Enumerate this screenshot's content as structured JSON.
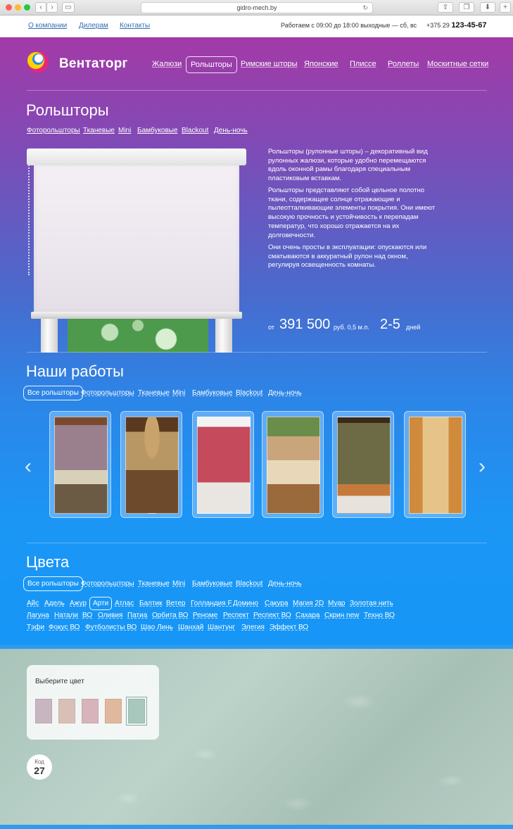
{
  "browser": {
    "url": "gidro-mech.by"
  },
  "topbar": {
    "links": [
      "О компании",
      "Дилерам",
      "Контакты"
    ],
    "hours": "Работаем с 09:00 до 18:00   выходные — сб, вс",
    "phone_prefix": "+375 29",
    "phone_number": "123-45-67"
  },
  "brand": {
    "name": "Вентаторг"
  },
  "nav": {
    "items": [
      "Жалюзи",
      "Рольшторы",
      "Римские шторы",
      "Японские",
      "Плиссе",
      "Роллеты",
      "Москитные сетки"
    ],
    "active": "Рольшторы"
  },
  "product": {
    "title": "Рольшторы",
    "subnav": [
      "Фоторольшторы",
      "Тканевые",
      "Mini",
      "Бамбуковые",
      "Blackout",
      "День-ночь"
    ],
    "paragraphs": [
      "Рольшторы (рулонные шторы) – декоративный вид рулонных жалюзи, которые удобно  перемещаются вдоль оконной рамы благодаря специальным пластиковым вставкам.",
      "Рольшторы представляют собой цельное полотно ткани, содержащее солнце отражающие и пылеотталкивающие элементы покрытия. Они имеют высокую прочность и устойчивость к перепадам температур, что хорошо отражается на их долговечности.",
      "Они очень просты в эксплуатации:  опускаются или сматываются в аккуратный рулон над окном, регулируя освещенность комнаты."
    ],
    "price_from": "от",
    "price": "391 500",
    "price_unit": "руб. 0,5 м.п.",
    "days": "2-5",
    "days_unit": "дней"
  },
  "works": {
    "title": "Наши работы",
    "filters": [
      "Все рольшторы",
      "Фоторольшторы",
      "Тканевые",
      "Mini",
      "Бамбуковые",
      "Blackout",
      "День-ночь"
    ],
    "photos": [
      "photo-1",
      "photo-2",
      "photo-3",
      "photo-4",
      "photo-5",
      "photo-6"
    ]
  },
  "colors": {
    "title": "Цвета",
    "filters": [
      "Все рольшторы",
      "Фоторольшторы",
      "Тканевые",
      "Mini",
      "Бамбуковые",
      "Blackout",
      "День-ночь"
    ],
    "row1": [
      "Айс",
      "Адель",
      "Ажур",
      "Арти",
      "Атлас",
      "Балтик",
      "Ветер",
      "Голландия F",
      "Домино",
      "Сакура",
      "Магия 2D",
      "Муар",
      "Золотая нить"
    ],
    "row2": [
      "Лагуна",
      "Натали",
      "ВО",
      "Оливия",
      "Патиа",
      "Орбита ВО",
      "Реноме",
      "Респект",
      "Респект ВО",
      "Сахара",
      "Скрин new",
      "Техно ВО"
    ],
    "row3": [
      "Тэфи",
      "Фокус ВО",
      "Футболисты ВО",
      "Шао Линь",
      "Шанхай",
      "Шантунг",
      "Элегия",
      "Эффект ВО"
    ],
    "selected": "Арти"
  },
  "picker": {
    "title": "Выберите цвет",
    "swatches": [
      "#c7b6c0",
      "#d9c0b7",
      "#d7b4bb",
      "#e0b89e",
      "#a9c8bd"
    ],
    "selected_index": 4
  },
  "code": {
    "label": "Код",
    "value": "27"
  }
}
